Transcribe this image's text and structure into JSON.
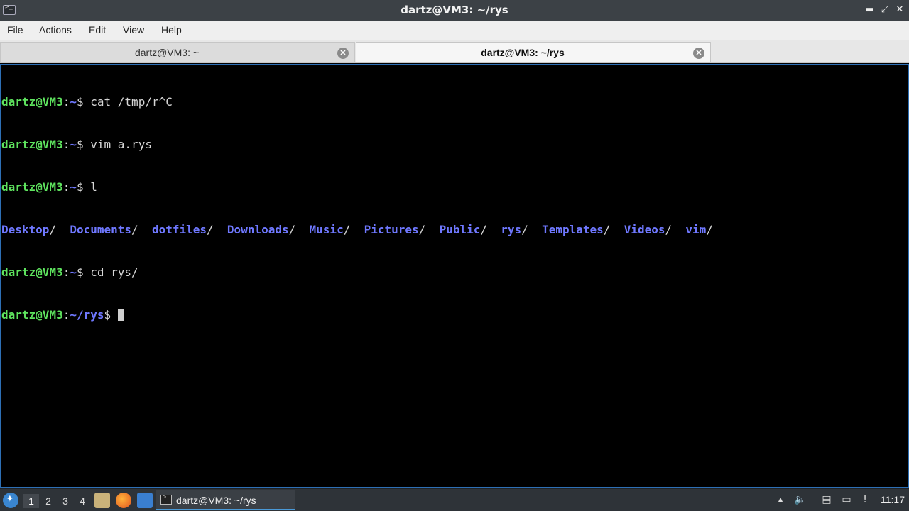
{
  "window": {
    "title": "dartz@VM3: ~/rys",
    "minimize_glyph": "▬",
    "maximize_glyph": "⤢",
    "close_glyph": "✕"
  },
  "menu": [
    "File",
    "Actions",
    "Edit",
    "View",
    "Help"
  ],
  "tabs": [
    {
      "label": "dartz@VM3: ~",
      "active": false
    },
    {
      "label": "dartz@VM3: ~/rys",
      "active": true
    }
  ],
  "terminal": {
    "prompt_user": "dartz@VM3",
    "lines": [
      {
        "path": "~",
        "command": " cat /tmp/r^C"
      },
      {
        "path": "~",
        "command": " vim a.rys"
      },
      {
        "path": "~",
        "command": " l"
      },
      {
        "path": "~",
        "command": " cd rys/"
      },
      {
        "path": "~/rys",
        "command": " "
      }
    ],
    "ls_output": [
      "Desktop",
      "Documents",
      "dotfiles",
      "Downloads",
      "Music",
      "Pictures",
      "Public",
      "rys",
      "Templates",
      "Videos",
      "vim"
    ]
  },
  "taskbar": {
    "workspaces": [
      "1",
      "2",
      "3",
      "4"
    ],
    "current_workspace": "1",
    "launchers": [
      "file-manager-icon",
      "firefox-icon",
      "desktop-icon"
    ],
    "task_label": "dartz@VM3: ~/rys",
    "clock": "11:17"
  },
  "colors": {
    "prompt_user": "#5ee35e",
    "prompt_path": "#6f78ff",
    "terminal_bg": "#000000",
    "accent": "#2d6fb5"
  }
}
